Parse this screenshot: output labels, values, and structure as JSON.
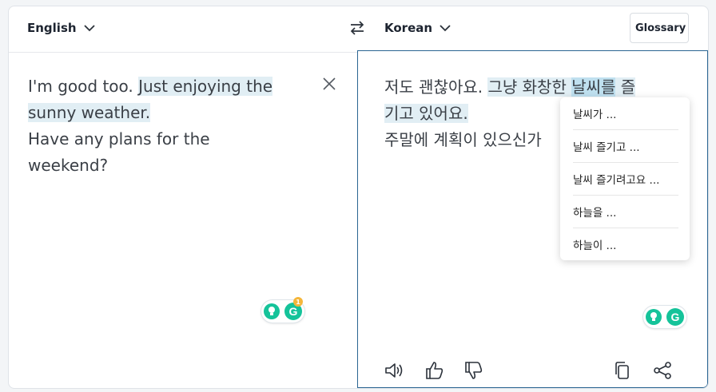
{
  "header": {
    "source_language": "English",
    "target_language": "Korean",
    "glossary_label": "Glossary"
  },
  "source": {
    "line1_plain": "I'm good too. ",
    "line1_hl": "Just enjoying the",
    "line2_hl": "sunny weather.",
    "line3": "Have any plans for the weekend?",
    "grammarly_notification_count": "1"
  },
  "translation": {
    "seg1": "저도 괜찮아요. ",
    "seg2_hl": "그냥 화창한 ",
    "seg3_selected": "날씨를",
    "seg4_hl": " 즐",
    "seg5_hl": "기고 있어요.",
    "seg6": "주말에 계획이 있으신가"
  },
  "alternatives": [
    "날씨가 ...",
    "날씨 즐기고 ...",
    "날씨 즐기려고요 ...",
    "하늘을 ...",
    "하늘이 ..."
  ],
  "icons": {
    "chevron": "chevron-down-icon",
    "swap": "swap-arrows-icon",
    "clear": "close-icon",
    "speaker": "speaker-icon",
    "like": "thumbs-up-icon",
    "dislike": "thumbs-down-icon",
    "copy": "copy-icon",
    "share": "share-icon"
  },
  "colors": {
    "highlight": "#e1eef4",
    "selected_highlight": "#bfe0ef",
    "active_border": "#2a6592",
    "grammarly_green": "#15c39a",
    "badge_orange": "#f5b63a"
  }
}
